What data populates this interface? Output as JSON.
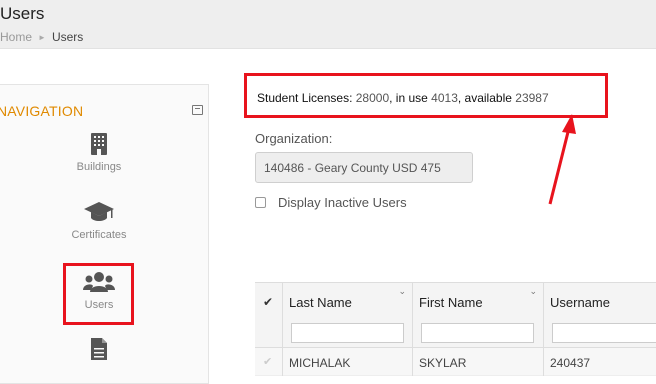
{
  "header": {
    "title": "Users",
    "breadcrumb": {
      "home": "Home",
      "current": "Users"
    }
  },
  "nav": {
    "title": "NAVIGATION",
    "items": [
      {
        "label": "Buildings",
        "icon": "building-icon"
      },
      {
        "label": "Certificates",
        "icon": "graduation-cap-icon"
      },
      {
        "label": "Users",
        "icon": "users-icon"
      },
      {
        "label": "",
        "icon": "document-icon"
      }
    ]
  },
  "licenses": {
    "label": "Student Licenses:",
    "total": "28000",
    "in_use_label": ", in use",
    "in_use": "4013",
    "available_label": ", available",
    "available": "23987"
  },
  "organization": {
    "label": "Organization:",
    "value": "140486 - Geary County USD 475"
  },
  "display_inactive": {
    "label": "Display Inactive Users",
    "checked": false
  },
  "table": {
    "columns": [
      "Last Name",
      "First Name",
      "Username"
    ],
    "rows": [
      {
        "last": "MICHALAK",
        "first": "SKYLAR",
        "username": "240437"
      }
    ]
  },
  "colors": {
    "highlight": "#e8131d",
    "nav_title": "#e08a00"
  }
}
